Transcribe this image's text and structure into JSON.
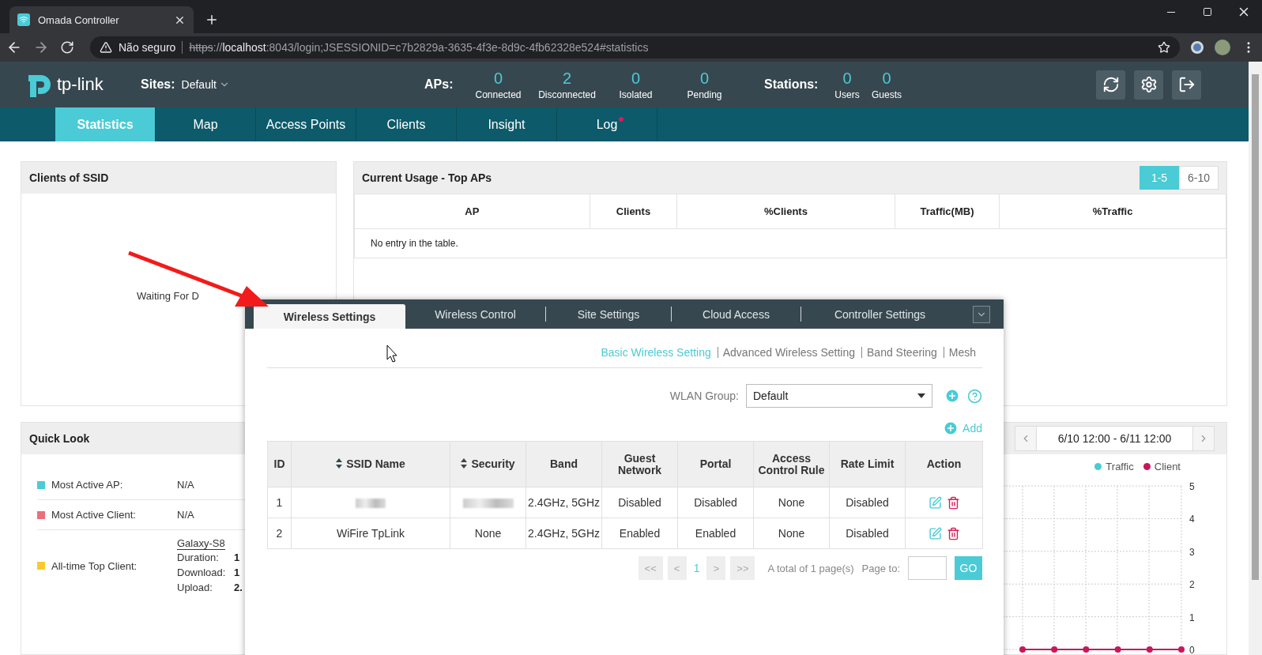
{
  "browser": {
    "tab_title": "Omada Controller",
    "security_label": "Não seguro",
    "url": {
      "scheme": "https",
      "separator": "://",
      "host": "localhost",
      "path": ":8043/login;JSESSIONID=c7b2829a-3635-4f3e-8d9c-4fb62328e524#statistics"
    }
  },
  "header": {
    "brand": "tp-link",
    "sites_label": "Sites:",
    "site": "Default",
    "aps_label": "APs:",
    "aps": [
      {
        "value": "0",
        "label": "Connected"
      },
      {
        "value": "2",
        "label": "Disconnected"
      },
      {
        "value": "0",
        "label": "Isolated"
      },
      {
        "value": "0",
        "label": "Pending"
      }
    ],
    "stations_label": "Stations:",
    "stations": [
      {
        "value": "0",
        "label": "Users"
      },
      {
        "value": "0",
        "label": "Guests"
      }
    ]
  },
  "nav": [
    {
      "label": "Statistics",
      "selected": true,
      "alert": false
    },
    {
      "label": "Map",
      "selected": false,
      "alert": false
    },
    {
      "label": "Access Points",
      "selected": false,
      "alert": false
    },
    {
      "label": "Clients",
      "selected": false,
      "alert": false
    },
    {
      "label": "Insight",
      "selected": false,
      "alert": false
    },
    {
      "label": "Log",
      "selected": false,
      "alert": true
    }
  ],
  "clients_of_ssid": {
    "title": "Clients of SSID",
    "message": "Waiting For D"
  },
  "current_usage": {
    "title": "Current Usage - Top APs",
    "pages": [
      {
        "label": "1-5",
        "selected": true
      },
      {
        "label": "6-10",
        "selected": false
      }
    ],
    "columns": [
      "AP",
      "Clients",
      "%Clients",
      "Traffic(MB)",
      "%Traffic"
    ],
    "empty_message": "No entry in the table."
  },
  "quick_look": {
    "title": "Quick Look",
    "items": [
      {
        "kind": "simple",
        "label": "Most Active AP:",
        "color": "#4acbd6",
        "value": "N/A"
      },
      {
        "kind": "simple",
        "label": "Most Active Client:",
        "color": "#ea6f7b",
        "value": "N/A"
      },
      {
        "kind": "client",
        "label": "All-time Top Client:",
        "color": "#f7cb2f",
        "client": "Galaxy-S8",
        "details": [
          {
            "label": "Duration:",
            "value": "1"
          },
          {
            "label": "Download:",
            "value": "1"
          },
          {
            "label": "Upload:",
            "value": "2."
          }
        ]
      }
    ]
  },
  "usage_chart": {
    "range": "6/10 12:00 - 6/11 12:00",
    "chart_data": {
      "type": "line",
      "grid": true,
      "ylim": [
        0,
        5
      ],
      "yticks": [
        {
          "value": 0,
          "label": "0"
        },
        {
          "value": 1,
          "label": "1"
        },
        {
          "value": 2,
          "label": "2"
        },
        {
          "value": 3,
          "label": "3"
        },
        {
          "value": 4,
          "label": "4"
        },
        {
          "value": 5,
          "label": "5"
        }
      ],
      "series": [
        {
          "name": "Traffic",
          "color": "#4acbd6",
          "values": [
            null,
            null,
            null,
            null,
            null,
            null
          ]
        },
        {
          "name": "Client",
          "color": "#c8175d",
          "marker": true,
          "values": [
            0,
            0,
            0,
            0,
            0,
            0
          ]
        }
      ]
    }
  },
  "modal": {
    "tabs": [
      {
        "label": "Wireless Settings",
        "selected": true
      },
      {
        "label": "Wireless Control",
        "selected": false
      },
      {
        "label": "Site Settings",
        "selected": false
      },
      {
        "label": "Cloud Access",
        "selected": false
      },
      {
        "label": "Controller Settings",
        "selected": false
      }
    ],
    "subtabs": [
      {
        "label": "Basic Wireless Setting",
        "selected": true
      },
      {
        "label": "Advanced Wireless Setting",
        "selected": false
      },
      {
        "label": "Band Steering",
        "selected": false
      },
      {
        "label": "Mesh",
        "selected": false
      }
    ],
    "wlan_group": {
      "label": "WLAN Group:",
      "value": "Default"
    },
    "add_label": "Add",
    "table": {
      "columns": [
        {
          "label": "ID",
          "sortable": false
        },
        {
          "label": "SSID Name",
          "sortable": true
        },
        {
          "label": "Security",
          "sortable": true
        },
        {
          "label": "Band",
          "sortable": false
        },
        {
          "label": "Guest Network",
          "sortable": false
        },
        {
          "label": "Portal",
          "sortable": false
        },
        {
          "label": "Access Control Rule",
          "sortable": false
        },
        {
          "label": "Rate Limit",
          "sortable": false
        },
        {
          "label": "Action",
          "sortable": false
        }
      ],
      "rows": [
        {
          "id": "1",
          "redacted": true,
          "band": "2.4GHz, 5GHz",
          "guest_network": "Disabled",
          "portal": "Disabled",
          "access_control_rule": "None",
          "rate_limit": "Disabled"
        },
        {
          "id": "2",
          "redacted": false,
          "ssid": "WiFire TpLink",
          "security": "None",
          "band": "2.4GHz, 5GHz",
          "guest_network": "Enabled",
          "portal": "Enabled",
          "access_control_rule": "None",
          "rate_limit": "Disabled"
        }
      ]
    },
    "pagination": {
      "first": "<<",
      "prev": "<",
      "pages": [
        {
          "label": "1",
          "selected": true
        }
      ],
      "next": ">",
      "last": ">>",
      "total": "A total of 1 page(s)",
      "page_to": "Page to:",
      "go": "GO"
    }
  }
}
